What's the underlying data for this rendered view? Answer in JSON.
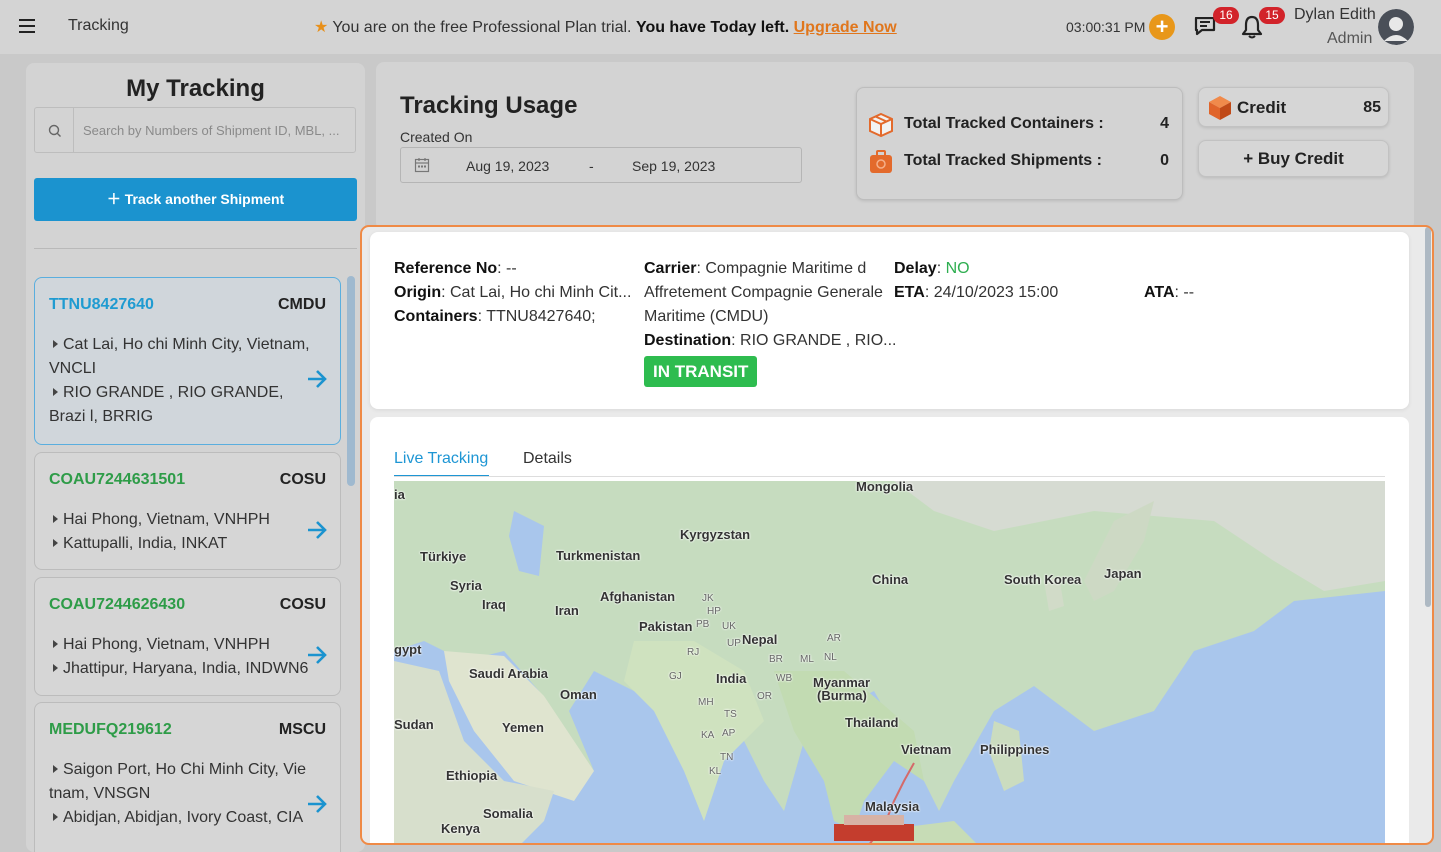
{
  "header": {
    "app_title": "Tracking",
    "trial_prefix": "You are on the free Professional Plan trial.",
    "trial_bold": "You have Today left.",
    "upgrade_link": "Upgrade Now",
    "time": "03:00:31 PM",
    "messages_count": "16",
    "notifications_count": "15",
    "user_name": "Dylan Edith",
    "user_role": "Admin"
  },
  "sidebar": {
    "title": "My Tracking",
    "search_placeholder": "Search by Numbers of Shipment ID, MBL, ...",
    "track_button": "Track another Shipment",
    "shipments": [
      {
        "id": "TTNU8427640",
        "carrier": "CMDU",
        "origin": "Cat Lai, Ho chi Minh City, Vietnam, VNCLI",
        "destination": "RIO GRANDE , RIO GRANDE, Brazi l, BRRIG"
      },
      {
        "id": "COAU7244631501",
        "carrier": "COSU",
        "origin": "Hai Phong, Vietnam, VNHPH",
        "destination": "Kattupalli, India, INKAT"
      },
      {
        "id": "COAU7244626430",
        "carrier": "COSU",
        "origin": "Hai Phong, Vietnam, VNHPH",
        "destination": "Jhattipur, Haryana, India, INDWN6"
      },
      {
        "id": "MEDUFQ219612",
        "carrier": "MSCU",
        "origin": "Saigon Port, Ho Chi Minh City, Vie tnam, VNSGN",
        "destination": "Abidjan, Abidjan, Ivory Coast, CIA"
      }
    ]
  },
  "usage": {
    "title": "Tracking Usage",
    "created_on_label": "Created On",
    "date_from": "Aug 19, 2023",
    "date_separator": "-",
    "date_to": "Sep 19, 2023",
    "total_containers_label": "Total Tracked Containers :",
    "total_containers_value": "4",
    "total_shipments_label": "Total Tracked Shipments :",
    "total_shipments_value": "0",
    "credit_label": "Credit",
    "credit_value": "85",
    "buy_credit_label": "+ Buy Credit"
  },
  "detail": {
    "reference_label": "Reference No",
    "reference_value": "--",
    "origin_label": "Origin",
    "origin_value": "Cat Lai, Ho chi Minh Cit...",
    "containers_label": "Containers",
    "containers_value": "TTNU8427640;",
    "carrier_label": "Carrier",
    "carrier_line1": "Compagnie Maritime d",
    "carrier_line2": "Affretement Compagnie Generale",
    "carrier_line3": "Maritime (CMDU)",
    "destination_label": "Destination",
    "destination_value": "RIO GRANDE , RIO...",
    "status": "IN TRANSIT",
    "delay_label": "Delay",
    "delay_value": "NO",
    "eta_label": "ETA",
    "eta_value": "24/10/2023 15:00",
    "ata_label": "ATA",
    "ata_value": "--"
  },
  "tabs": {
    "live": "Live Tracking",
    "details": "Details"
  },
  "map_labels": {
    "mongolia": "Mongolia",
    "kyrgyzstan": "Kyrgyzstan",
    "turkiye": "Türkiye",
    "turkmenistan": "Turkmenistan",
    "china": "China",
    "south_korea": "South Korea",
    "japan": "Japan",
    "syria": "Syria",
    "iraq": "Iraq",
    "iran": "Iran",
    "afghanistan": "Afghanistan",
    "pakistan": "Pakistan",
    "nepal": "Nepal",
    "egypt": "gypt",
    "saudi": "Saudi Arabia",
    "oman": "Oman",
    "india": "India",
    "myanmar": "Myanmar",
    "burma": "(Burma)",
    "thailand": "Thailand",
    "sudan": "Sudan",
    "yemen": "Yemen",
    "vietnam": "Vietnam",
    "philippines": "Philippines",
    "ethiopia": "Ethiopia",
    "somalia": "Somalia",
    "malaysia": "Malaysia",
    "kenya": "Kenya",
    "ia": "ia",
    "jk": "JK",
    "hp": "HP",
    "pb": "PB",
    "uk": "UK",
    "up": "UP",
    "rj": "RJ",
    "gj": "GJ",
    "mh": "MH",
    "ts": "TS",
    "ka": "KA",
    "ap": "AP",
    "tn": "TN",
    "kl": "KL",
    "or": "OR",
    "wb": "WB",
    "br": "BR",
    "ml": "ML",
    "nl": "NL",
    "ar": "AR"
  }
}
